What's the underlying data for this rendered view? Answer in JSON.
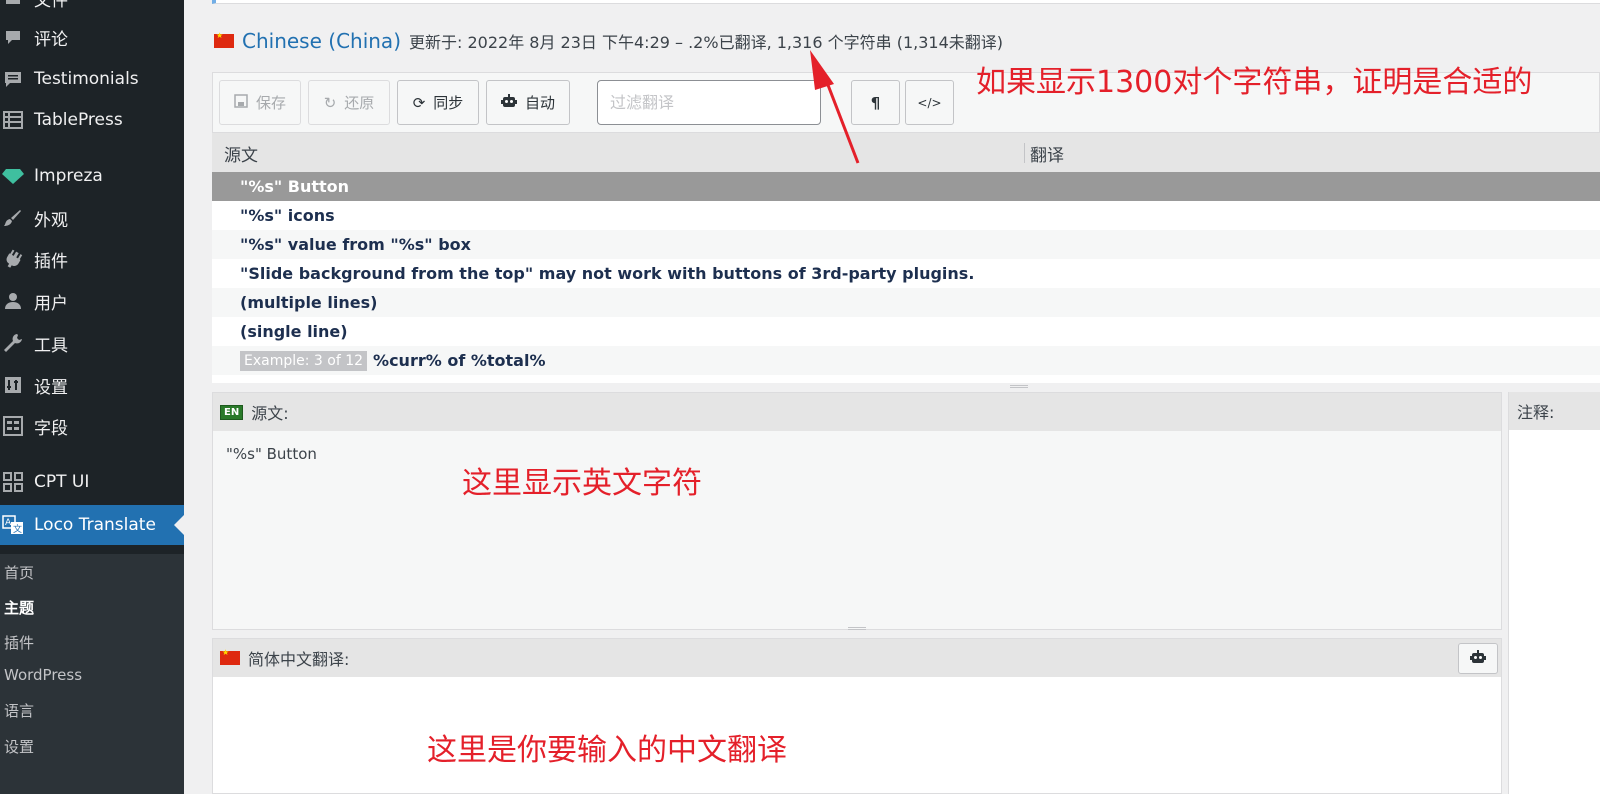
{
  "sidebar": {
    "items": [
      {
        "label": "文件",
        "icon": "media-icon"
      },
      {
        "label": "评论",
        "icon": "comment-icon"
      },
      {
        "label": "Testimonials",
        "icon": "testimonial-icon"
      },
      {
        "label": "TablePress",
        "icon": "table-icon"
      },
      {
        "label": "Impreza",
        "icon": "diamond-icon"
      },
      {
        "label": "外观",
        "icon": "paintbrush-icon"
      },
      {
        "label": "插件",
        "icon": "plugin-icon"
      },
      {
        "label": "用户",
        "icon": "user-icon"
      },
      {
        "label": "工具",
        "icon": "wrench-icon"
      },
      {
        "label": "设置",
        "icon": "settings-icon"
      },
      {
        "label": "字段",
        "icon": "fields-icon"
      },
      {
        "label": "CPT UI",
        "icon": "grid-icon"
      },
      {
        "label": "Loco Translate",
        "icon": "translate-icon"
      }
    ],
    "submenu": [
      "首页",
      "主题",
      "插件",
      "WordPress",
      "语言",
      "设置"
    ],
    "submenu_current": "主题"
  },
  "header": {
    "language": "Chinese (China)",
    "meta": "更新于: 2022年 8月 23日 下午4:29 – .2%已翻译, 1,316 个字符串 (1,314未翻译)"
  },
  "toolbar": {
    "save": "保存",
    "revert": "还原",
    "sync": "同步",
    "auto": "自动",
    "filter_placeholder": "过滤翻译",
    "pilcrow": "¶",
    "code": "</>"
  },
  "columns": {
    "source": "源文",
    "translation": "翻译"
  },
  "rows": [
    {
      "text": "\"%s\" Button",
      "context": ""
    },
    {
      "text": "\"%s\" icons",
      "context": ""
    },
    {
      "text": "\"%s\" value from \"%s\" box",
      "context": ""
    },
    {
      "text": "\"Slide background from the top\" may not work with buttons of 3rd-party plugins.",
      "context": ""
    },
    {
      "text": "(multiple lines)",
      "context": ""
    },
    {
      "text": "(single line)",
      "context": ""
    },
    {
      "text": "%curr% of %total%",
      "context": "Example: 3 of 12"
    }
  ],
  "source_pane": {
    "badge": "EN",
    "label": "源文:",
    "text": "\"%s\" Button"
  },
  "target_pane": {
    "label": "简体中文翻译:"
  },
  "notes_pane": {
    "label": "注释:"
  },
  "annotations": {
    "count_note": "如果显示1300对个字符串，证明是合适的",
    "source_note": "这里显示英文字符",
    "target_note": "这里是你要输入的中文翻译"
  },
  "colors": {
    "annotation": "#e4202a",
    "sidebar": "#1d2327",
    "accent": "#2271b1"
  }
}
